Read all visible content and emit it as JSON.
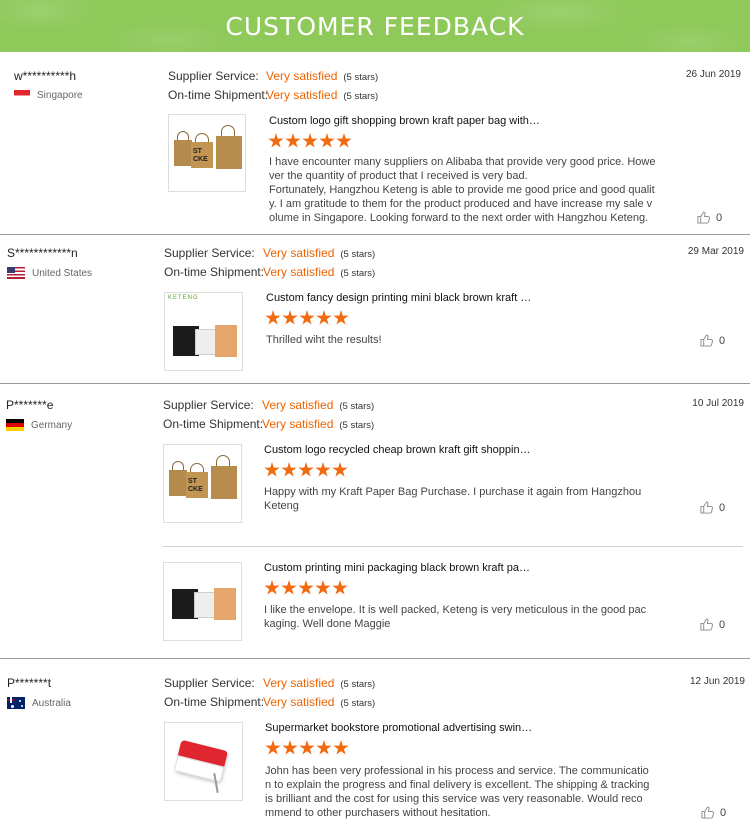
{
  "header": {
    "title": "CUSTOMER FEEDBACK"
  },
  "labels": {
    "supplier_service": "Supplier Service:",
    "ontime_shipment": "On-time Shipment:"
  },
  "reviews": [
    {
      "user": "w**********h",
      "country": "Singapore",
      "date": "26 Jun 2019",
      "supplier_rating": "Very satisfied",
      "supplier_stars": "(5 stars)",
      "shipment_rating": "Very satisfied",
      "shipment_stars": "(5 stars)",
      "products": [
        {
          "title": "Custom logo gift shopping brown kraft paper bag with…",
          "stars": 5,
          "comment_lines": [
            "I have encounter many suppliers on Alibaba that provide very good price. Howe",
            "ver the quantity of product that I received is very bad.",
            "Fortunately, Hangzhou Keteng is able to provide me good price and good qualit",
            "y. I am gratitude to them for the product produced and have increase my sale v",
            "olume in Singapore. Looking forward to the next order with Hangzhou Keteng."
          ],
          "likes": "0"
        }
      ]
    },
    {
      "user": "S************n",
      "country": "United States",
      "date": "29 Mar 2019",
      "supplier_rating": "Very satisfied",
      "supplier_stars": "(5 stars)",
      "shipment_rating": "Very satisfied",
      "shipment_stars": "(5 stars)",
      "products": [
        {
          "title": "Custom fancy design printing mini black brown kraft …",
          "thumb_brand": "KETENG",
          "stars": 5,
          "comment_lines": [
            "Thrilled wiht the results!"
          ],
          "likes": "0"
        }
      ]
    },
    {
      "user": "P*******e",
      "country": "Germany",
      "date": "10 Jul 2019",
      "supplier_rating": "Very satisfied",
      "supplier_stars": "(5 stars)",
      "shipment_rating": "Very satisfied",
      "shipment_stars": "(5 stars)",
      "products": [
        {
          "title": "Custom logo recycled cheap brown kraft gift shoppin…",
          "stars": 5,
          "comment_lines": [
            "Happy with my Kraft Paper Bag Purchase. I purchase it again from Hangzhou",
            "Keteng"
          ],
          "likes": "0"
        },
        {
          "title": "Custom printing mini packaging black brown kraft pa…",
          "stars": 5,
          "comment_lines": [
            "I like the envelope. It is well packed, Keteng is very meticulous in the good pac",
            "kaging. Well done Maggie"
          ],
          "likes": "0"
        }
      ]
    },
    {
      "user": "P*******t",
      "country": "Australia",
      "date": "12 Jun 2019",
      "supplier_rating": "Very satisfied",
      "supplier_stars": "(5 stars)",
      "shipment_rating": "Very satisfied",
      "shipment_stars": "(5 stars)",
      "products": [
        {
          "title": "Supermarket bookstore promotional advertising swin…",
          "stars": 5,
          "comment_lines": [
            "John has been very professional in his process and service. The communicatio",
            "n to explain the progress and final delivery is excellent. The shipping & tracking",
            "is brilliant and the cost for using this service was very reasonable. Would reco",
            "mmend to other purchasers without hesitation."
          ],
          "likes": "0"
        }
      ]
    }
  ]
}
